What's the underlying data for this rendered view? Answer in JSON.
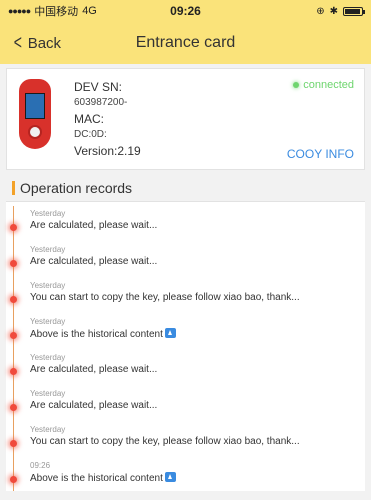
{
  "status_bar": {
    "carrier": "中国移动",
    "network": "4G",
    "time": "09:26"
  },
  "nav": {
    "back_label": "Back",
    "title": "Entrance card"
  },
  "device": {
    "sn_label": "DEV SN:",
    "sn_value": "603987200-",
    "mac_label": "MAC:",
    "mac_value": "DC:0D:",
    "version": "Version:2.19",
    "status": "connected",
    "copy_info": "COOY INFO"
  },
  "records_section": {
    "title": "Operation records"
  },
  "records": [
    {
      "time": "Yesterday",
      "text": "Are calculated, please wait...",
      "icon": false
    },
    {
      "time": "Yesterday",
      "text": "Are calculated, please wait...",
      "icon": false
    },
    {
      "time": "Yesterday",
      "text": "You can start to copy the key, please follow xiao bao, thank...",
      "icon": false
    },
    {
      "time": "Yesterday",
      "text": "Above is the historical content",
      "icon": true
    },
    {
      "time": "Yesterday",
      "text": "Are calculated, please wait...",
      "icon": false
    },
    {
      "time": "Yesterday",
      "text": "Are calculated, please wait...",
      "icon": false
    },
    {
      "time": "Yesterday",
      "text": "You can start to copy the key, please follow xiao bao, thank...",
      "icon": false
    },
    {
      "time": "09:26",
      "text": "Above is the historical content",
      "icon": true
    }
  ],
  "colors": {
    "nav_bg": "#fae37a",
    "connected": "#6ed56e",
    "link": "#3a8be0",
    "timeline_dot": "#f04a3c",
    "section_accent": "#f3a229"
  }
}
